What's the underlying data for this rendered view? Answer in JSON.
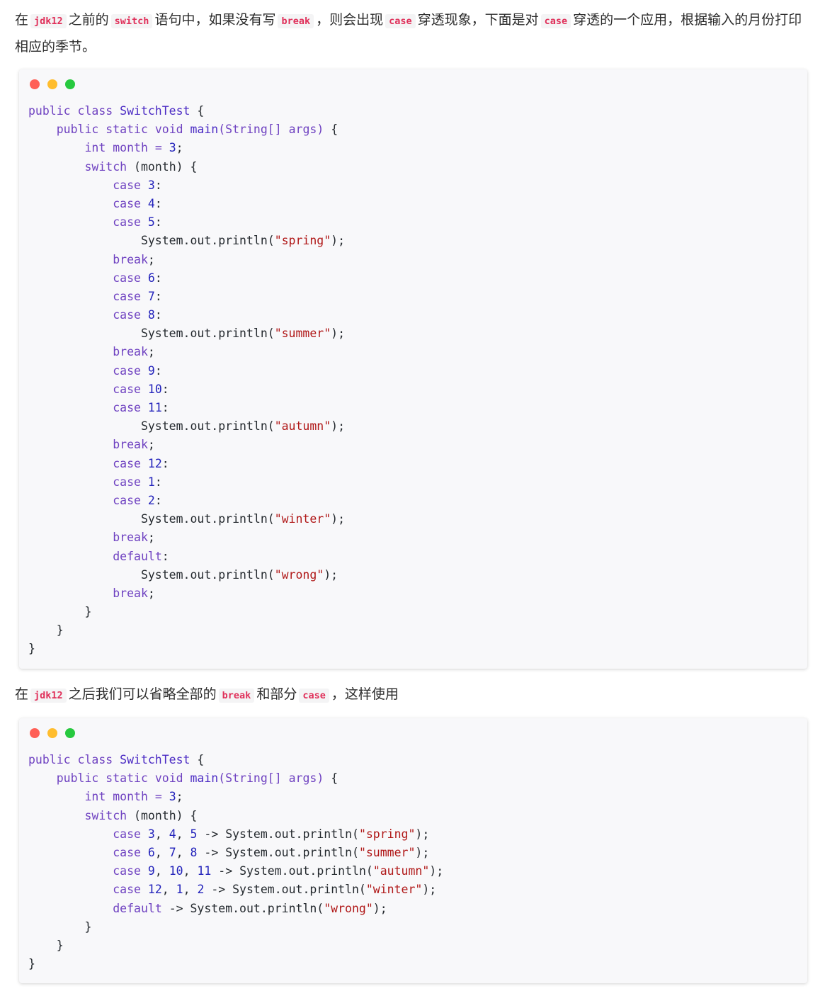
{
  "paragraph_1": {
    "t1": "在",
    "c1": "jdk12",
    "t2": "之前的",
    "c2": "switch",
    "t3": "语句中，如果没有写",
    "c3": "break",
    "t4": "，则会出现",
    "c4": "case",
    "t5": "穿透现象，下面是对",
    "c5": "case",
    "t6": "穿透的一个应用，根据输入的月份打印相应的季节。"
  },
  "paragraph_2": {
    "t1": "在",
    "c1": "jdk12",
    "t2": "之后我们可以省略全部的",
    "c2": "break",
    "t3": "和部分",
    "c3": "case",
    "t4": "，这样使用"
  },
  "colors": {
    "keyword": "#6f42c1",
    "class_name": "#4b2bc4",
    "number": "#2222bb",
    "string": "#b01818",
    "inline_code": "#e0305a",
    "dot_red": "#ff5f56",
    "dot_yellow": "#ffbd2e",
    "dot_green": "#27c93f"
  },
  "code_block_1": [
    [
      [
        "kw",
        "public class "
      ],
      [
        "cls",
        "SwitchTest"
      ],
      [
        "pl",
        " {"
      ]
    ],
    [
      [
        "pl",
        "    "
      ],
      [
        "kw",
        "public static void "
      ],
      [
        "cls",
        "main"
      ],
      [
        "kw",
        "(String[] args) "
      ],
      [
        "pl",
        "{"
      ]
    ],
    [
      [
        "pl",
        "        "
      ],
      [
        "kw",
        "int month = "
      ],
      [
        "num",
        "3"
      ],
      [
        "pl",
        ";"
      ]
    ],
    [
      [
        "pl",
        "        "
      ],
      [
        "kw",
        "switch "
      ],
      [
        "pl",
        "(month) {"
      ]
    ],
    [
      [
        "pl",
        "            "
      ],
      [
        "kw",
        "case "
      ],
      [
        "num",
        "3"
      ],
      [
        "pl",
        ":"
      ]
    ],
    [
      [
        "pl",
        "            "
      ],
      [
        "kw",
        "case "
      ],
      [
        "num",
        "4"
      ],
      [
        "pl",
        ":"
      ]
    ],
    [
      [
        "pl",
        "            "
      ],
      [
        "kw",
        "case "
      ],
      [
        "num",
        "5"
      ],
      [
        "pl",
        ":"
      ]
    ],
    [
      [
        "pl",
        "                System.out.println("
      ],
      [
        "str",
        "\"spring\""
      ],
      [
        "pl",
        ");"
      ]
    ],
    [
      [
        "pl",
        "            "
      ],
      [
        "kw",
        "break"
      ],
      [
        "pl",
        ";"
      ]
    ],
    [
      [
        "pl",
        "            "
      ],
      [
        "kw",
        "case "
      ],
      [
        "num",
        "6"
      ],
      [
        "pl",
        ":"
      ]
    ],
    [
      [
        "pl",
        "            "
      ],
      [
        "kw",
        "case "
      ],
      [
        "num",
        "7"
      ],
      [
        "pl",
        ":"
      ]
    ],
    [
      [
        "pl",
        "            "
      ],
      [
        "kw",
        "case "
      ],
      [
        "num",
        "8"
      ],
      [
        "pl",
        ":"
      ]
    ],
    [
      [
        "pl",
        "                System.out.println("
      ],
      [
        "str",
        "\"summer\""
      ],
      [
        "pl",
        ");"
      ]
    ],
    [
      [
        "pl",
        "            "
      ],
      [
        "kw",
        "break"
      ],
      [
        "pl",
        ";"
      ]
    ],
    [
      [
        "pl",
        "            "
      ],
      [
        "kw",
        "case "
      ],
      [
        "num",
        "9"
      ],
      [
        "pl",
        ":"
      ]
    ],
    [
      [
        "pl",
        "            "
      ],
      [
        "kw",
        "case "
      ],
      [
        "num",
        "10"
      ],
      [
        "pl",
        ":"
      ]
    ],
    [
      [
        "pl",
        "            "
      ],
      [
        "kw",
        "case "
      ],
      [
        "num",
        "11"
      ],
      [
        "pl",
        ":"
      ]
    ],
    [
      [
        "pl",
        "                System.out.println("
      ],
      [
        "str",
        "\"autumn\""
      ],
      [
        "pl",
        ");"
      ]
    ],
    [
      [
        "pl",
        "            "
      ],
      [
        "kw",
        "break"
      ],
      [
        "pl",
        ";"
      ]
    ],
    [
      [
        "pl",
        "            "
      ],
      [
        "kw",
        "case "
      ],
      [
        "num",
        "12"
      ],
      [
        "pl",
        ":"
      ]
    ],
    [
      [
        "pl",
        "            "
      ],
      [
        "kw",
        "case "
      ],
      [
        "num",
        "1"
      ],
      [
        "pl",
        ":"
      ]
    ],
    [
      [
        "pl",
        "            "
      ],
      [
        "kw",
        "case "
      ],
      [
        "num",
        "2"
      ],
      [
        "pl",
        ":"
      ]
    ],
    [
      [
        "pl",
        "                System.out.println("
      ],
      [
        "str",
        "\"winter\""
      ],
      [
        "pl",
        ");"
      ]
    ],
    [
      [
        "pl",
        "            "
      ],
      [
        "kw",
        "break"
      ],
      [
        "pl",
        ";"
      ]
    ],
    [
      [
        "pl",
        "            "
      ],
      [
        "kw",
        "default"
      ],
      [
        "pl",
        ":"
      ]
    ],
    [
      [
        "pl",
        "                System.out.println("
      ],
      [
        "str",
        "\"wrong\""
      ],
      [
        "pl",
        ");"
      ]
    ],
    [
      [
        "pl",
        "            "
      ],
      [
        "kw",
        "break"
      ],
      [
        "pl",
        ";"
      ]
    ],
    [
      [
        "pl",
        "        }"
      ]
    ],
    [
      [
        "pl",
        "    }"
      ]
    ],
    [
      [
        "pl",
        "}"
      ]
    ]
  ],
  "code_block_2": [
    [
      [
        "kw",
        "public class "
      ],
      [
        "cls",
        "SwitchTest"
      ],
      [
        "pl",
        " {"
      ]
    ],
    [
      [
        "pl",
        "    "
      ],
      [
        "kw",
        "public static void "
      ],
      [
        "cls",
        "main"
      ],
      [
        "kw",
        "(String[] args) "
      ],
      [
        "pl",
        "{"
      ]
    ],
    [
      [
        "pl",
        "        "
      ],
      [
        "kw",
        "int month = "
      ],
      [
        "num",
        "3"
      ],
      [
        "pl",
        ";"
      ]
    ],
    [
      [
        "pl",
        "        "
      ],
      [
        "kw",
        "switch "
      ],
      [
        "pl",
        "(month) {"
      ]
    ],
    [
      [
        "pl",
        "            "
      ],
      [
        "kw",
        "case "
      ],
      [
        "num",
        "3"
      ],
      [
        "pl",
        ", "
      ],
      [
        "num",
        "4"
      ],
      [
        "pl",
        ", "
      ],
      [
        "num",
        "5"
      ],
      [
        "pl",
        " -> System.out.println("
      ],
      [
        "str",
        "\"spring\""
      ],
      [
        "pl",
        ");"
      ]
    ],
    [
      [
        "pl",
        "            "
      ],
      [
        "kw",
        "case "
      ],
      [
        "num",
        "6"
      ],
      [
        "pl",
        ", "
      ],
      [
        "num",
        "7"
      ],
      [
        "pl",
        ", "
      ],
      [
        "num",
        "8"
      ],
      [
        "pl",
        " -> System.out.println("
      ],
      [
        "str",
        "\"summer\""
      ],
      [
        "pl",
        ");"
      ]
    ],
    [
      [
        "pl",
        "            "
      ],
      [
        "kw",
        "case "
      ],
      [
        "num",
        "9"
      ],
      [
        "pl",
        ", "
      ],
      [
        "num",
        "10"
      ],
      [
        "pl",
        ", "
      ],
      [
        "num",
        "11"
      ],
      [
        "pl",
        " -> System.out.println("
      ],
      [
        "str",
        "\"autumn\""
      ],
      [
        "pl",
        ");"
      ]
    ],
    [
      [
        "pl",
        "            "
      ],
      [
        "kw",
        "case "
      ],
      [
        "num",
        "12"
      ],
      [
        "pl",
        ", "
      ],
      [
        "num",
        "1"
      ],
      [
        "pl",
        ", "
      ],
      [
        "num",
        "2"
      ],
      [
        "pl",
        " -> System.out.println("
      ],
      [
        "str",
        "\"winter\""
      ],
      [
        "pl",
        ");"
      ]
    ],
    [
      [
        "pl",
        "            "
      ],
      [
        "kw",
        "default"
      ],
      [
        "pl",
        " -> System.out.println("
      ],
      [
        "str",
        "\"wrong\""
      ],
      [
        "pl",
        ");"
      ]
    ],
    [
      [
        "pl",
        "        }"
      ]
    ],
    [
      [
        "pl",
        "    }"
      ]
    ],
    [
      [
        "pl",
        "}"
      ]
    ]
  ]
}
